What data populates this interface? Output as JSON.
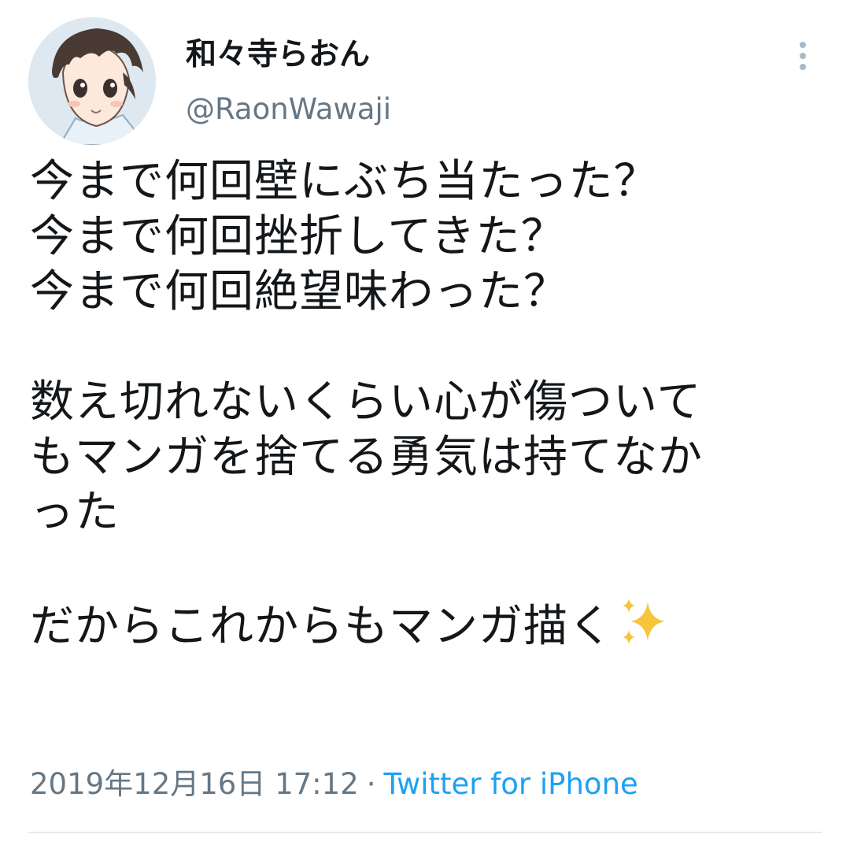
{
  "user": {
    "display_name": "和々寺らおん",
    "handle": "@RaonWawaji",
    "avatar_icon": "anime-boy-avatar"
  },
  "more_icon": "vertical-ellipsis-icon",
  "tweet": {
    "lines": [
      "今まで何回壁にぶち当たった？",
      "今まで何回挫折してきた？",
      "今まで何回絶望味わった？",
      "",
      "数え切れないくらい心が傷ついて",
      "もマンガを捨てる勇気は持てなか",
      "った",
      "",
      "だからこれからもマンガ描く"
    ],
    "emoji": "sparkles-icon"
  },
  "meta": {
    "timestamp": "2019年12月16日 17:12",
    "separator": "·",
    "source": "Twitter for iPhone"
  },
  "colors": {
    "text": "#14171a",
    "muted": "#657786",
    "link": "#1da1f2",
    "sparkle": "#f7c43c"
  }
}
